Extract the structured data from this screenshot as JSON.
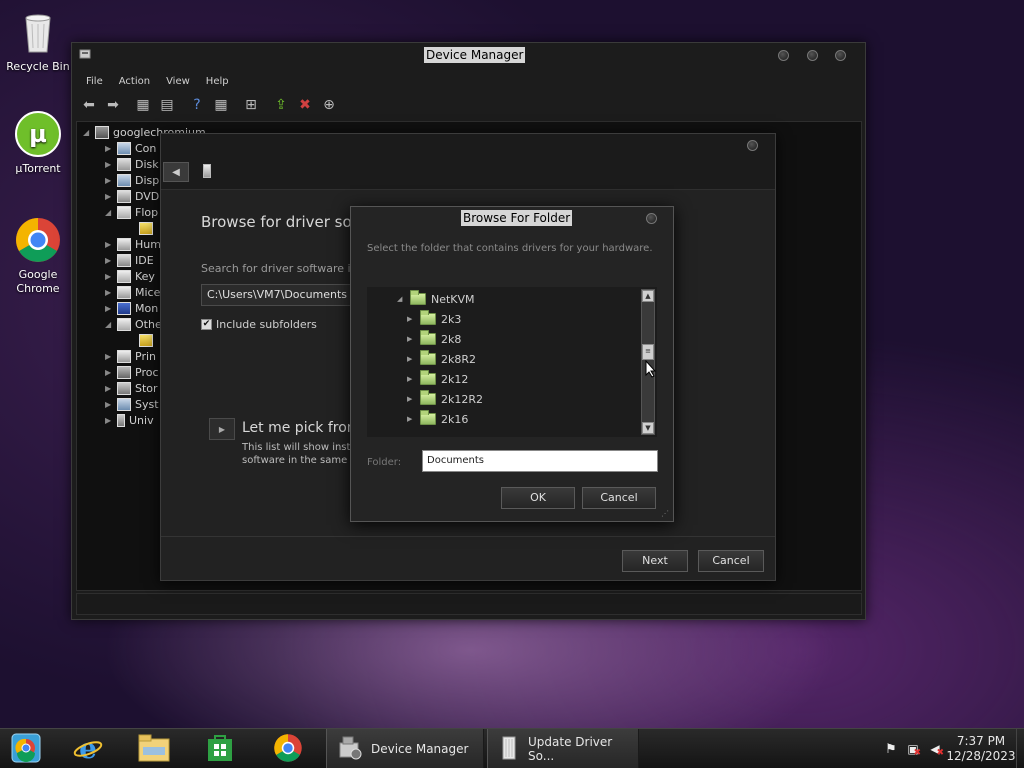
{
  "desktop": {
    "icons": [
      {
        "label": "Recycle Bin"
      },
      {
        "label": "µTorrent"
      },
      {
        "label": "Google Chrome"
      }
    ]
  },
  "device_manager": {
    "title": "Device Manager",
    "menu": [
      "File",
      "Action",
      "View",
      "Help"
    ],
    "tree_root": "googlechromium",
    "tree_items": [
      "Con",
      "Disk",
      "Disp",
      "DVD",
      "Flop",
      "Hum",
      "IDE",
      "Key",
      "Mice",
      "Mon",
      "Othe",
      "Prin",
      "Proc",
      "Stor",
      "Syst",
      "Univ"
    ]
  },
  "wizard": {
    "title": "Browse for driver soft",
    "search_label": "Search for driver software in",
    "path": "C:\\Users\\VM7\\Documents",
    "include_subfolders": "Include subfolders",
    "pick_title": "Let me pick fron",
    "pick_desc_1": "This list will show inst",
    "pick_desc_2": "software in the same",
    "next": "Next",
    "cancel": "Cancel"
  },
  "browse_folder": {
    "title": "Browse For Folder",
    "description": "Select the folder that contains drivers for your hardware.",
    "parent_folder": "NetKVM",
    "folders": [
      "2k3",
      "2k8",
      "2k8R2",
      "2k12",
      "2k12R2",
      "2k16"
    ],
    "folder_label": "Folder:",
    "folder_value": "Documents",
    "ok": "OK",
    "cancel": "Cancel"
  },
  "taskbar": {
    "tasks": [
      {
        "label": "Device Manager",
        "icon": "device-manager-icon"
      },
      {
        "label": "Update Driver So...",
        "icon": "update-driver-icon"
      }
    ],
    "time": "7:37 PM",
    "date": "12/28/2023"
  },
  "colors": {
    "accent_green": "#8fb860",
    "window_bg": "#1c1c1c",
    "title_highlight": "#d6d6d6"
  }
}
